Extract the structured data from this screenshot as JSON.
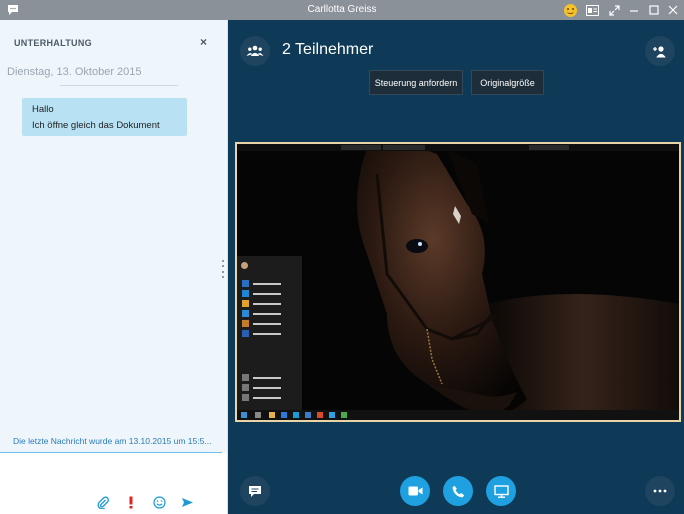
{
  "window": {
    "title": "Carllotta Greiss"
  },
  "conversation": {
    "header": "UNTERHALTUNG",
    "close_label": "×",
    "date": "Dienstag, 13. Oktober 2015",
    "message_lines": [
      "Hallo",
      "Ich öffne gleich das Dokument"
    ],
    "last_message_status": "Die letzte Nachricht wurde am 13.10.2015 um 15:5..."
  },
  "call": {
    "participants_label": "2 Teilnehmer",
    "request_control_label": "Steuerung anfordern",
    "original_size_label": "Originalgröße"
  },
  "colors": {
    "call_background": "#0e3a57",
    "call_button": "#1fa0e1",
    "message_bubble": "#b8e1f4",
    "title_bar": "#8a9198"
  },
  "icons": {
    "title_bar": [
      "skype-chat-icon",
      "emoji-icon",
      "contacts-card-icon",
      "popout-icon",
      "minimize-icon",
      "maximize-icon",
      "close-icon"
    ],
    "compose": [
      "attach-icon",
      "important-icon",
      "emoticon-icon",
      "send-icon"
    ],
    "call_controls": [
      "chat-icon",
      "video-icon",
      "call-icon",
      "screen-share-icon",
      "more-icon"
    ]
  }
}
